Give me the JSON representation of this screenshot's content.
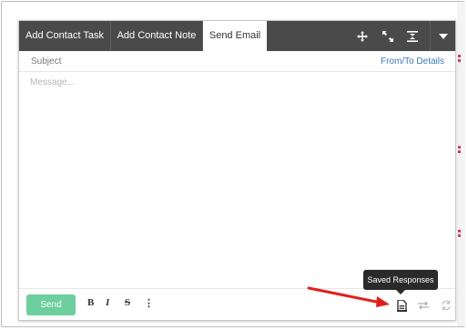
{
  "tabs": [
    {
      "label": "Add Contact Task"
    },
    {
      "label": "Add Contact Note"
    },
    {
      "label": "Send Email"
    }
  ],
  "toolbar_icons": [
    "move-icon",
    "expand-icon",
    "collapse-icon",
    "dropdown-caret-icon"
  ],
  "compose": {
    "subject_label": "Subject",
    "from_to_link": "From/To Details",
    "message_placeholder": "Message..."
  },
  "footer": {
    "send_label": "Send",
    "bold": "B",
    "italic": "I",
    "strikethrough": "S",
    "more": "⋮"
  },
  "tooltip": {
    "text": "Saved Responses"
  },
  "colors": {
    "tabbar": "#4a4a4a",
    "send_button": "#6ccf9d",
    "link": "#3a79b8",
    "annotation_arrow": "#e0201c",
    "tooltip_bg": "#2a2a2a"
  }
}
